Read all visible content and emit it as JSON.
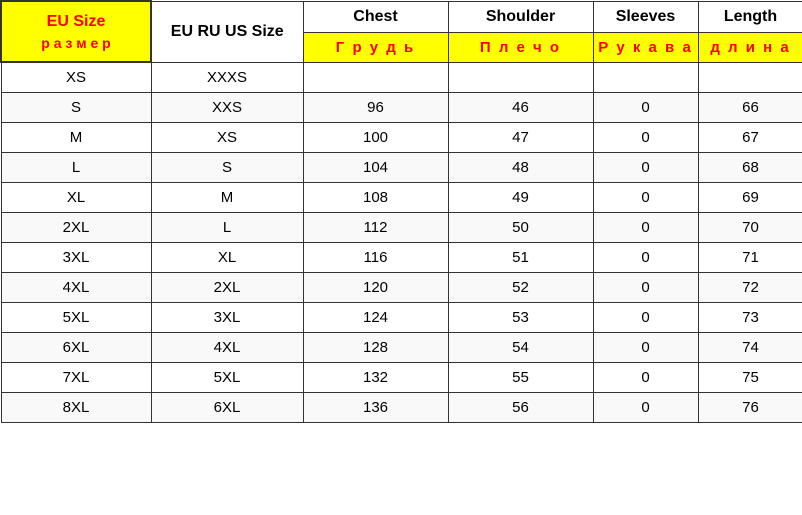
{
  "headers": {
    "eu_size": "EU Size",
    "eu_ru_us": "EU RU US Size",
    "chest": "Chest",
    "shoulder": "Shoulder",
    "sleeves": "Sleeves",
    "length": "Length",
    "razmer": "р а з м е р",
    "grud": "Г р у д ь",
    "plecho": "П л е ч о",
    "rukava": "Р у к а в а",
    "dlina": "д л и н а"
  },
  "rows": [
    {
      "eu": "XS",
      "rurus": "XXXS",
      "chest": "",
      "shoulder": "",
      "sleeves": "",
      "length": ""
    },
    {
      "eu": "S",
      "rurus": "XXS",
      "chest": "96",
      "shoulder": "46",
      "sleeves": "0",
      "length": "66"
    },
    {
      "eu": "M",
      "rurus": "XS",
      "chest": "100",
      "shoulder": "47",
      "sleeves": "0",
      "length": "67"
    },
    {
      "eu": "L",
      "rurus": "S",
      "chest": "104",
      "shoulder": "48",
      "sleeves": "0",
      "length": "68"
    },
    {
      "eu": "XL",
      "rurus": "M",
      "chest": "108",
      "shoulder": "49",
      "sleeves": "0",
      "length": "69"
    },
    {
      "eu": "2XL",
      "rurus": "L",
      "chest": "112",
      "shoulder": "50",
      "sleeves": "0",
      "length": "70"
    },
    {
      "eu": "3XL",
      "rurus": "XL",
      "chest": "116",
      "shoulder": "51",
      "sleeves": "0",
      "length": "71"
    },
    {
      "eu": "4XL",
      "rurus": "2XL",
      "chest": "120",
      "shoulder": "52",
      "sleeves": "0",
      "length": "72"
    },
    {
      "eu": "5XL",
      "rurus": "3XL",
      "chest": "124",
      "shoulder": "53",
      "sleeves": "0",
      "length": "73"
    },
    {
      "eu": "6XL",
      "rurus": "4XL",
      "chest": "128",
      "shoulder": "54",
      "sleeves": "0",
      "length": "74"
    },
    {
      "eu": "7XL",
      "rurus": "5XL",
      "chest": "132",
      "shoulder": "55",
      "sleeves": "0",
      "length": "75"
    },
    {
      "eu": "8XL",
      "rurus": "6XL",
      "chest": "136",
      "shoulder": "56",
      "sleeves": "0",
      "length": "76"
    }
  ]
}
